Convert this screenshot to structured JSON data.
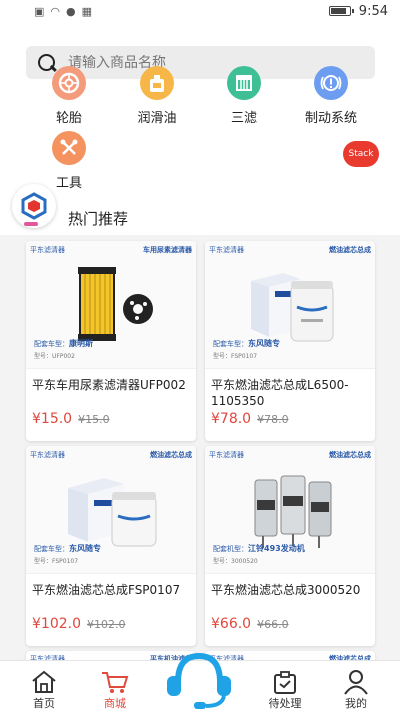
{
  "status_bar": {
    "time": "9:54"
  },
  "search": {
    "placeholder": "请输入商品名称"
  },
  "categories": [
    {
      "label": "轮胎",
      "icon": "tire-icon",
      "color": "#f39b7b"
    },
    {
      "label": "润滑油",
      "icon": "oil-bottle-icon",
      "color": "#f7b648"
    },
    {
      "label": "三滤",
      "icon": "filter-icon",
      "color": "#3fbf95"
    },
    {
      "label": "制动系统",
      "icon": "brake-warning-icon",
      "color": "#6d9df0"
    },
    {
      "label": "工具",
      "icon": "tools-icon",
      "color": "#f4935f"
    }
  ],
  "stack_button": {
    "label": "Stack"
  },
  "hot_section": {
    "title": "热门推荐"
  },
  "products": [
    {
      "name": "平东车用尿素滤清器UFP002",
      "price": "¥15.0",
      "old_price": "¥15.0",
      "brand": "平东滤清器",
      "image_type": "车用尿素滤清器",
      "fit_label": "配套车型：",
      "fit_value": "康明斯",
      "model": "型号：UFP002"
    },
    {
      "name": "平东燃油滤芯总成L6500-1105350",
      "price": "¥78.0",
      "old_price": "¥78.0",
      "brand": "平东滤清器",
      "image_type": "燃油滤芯总成",
      "fit_label": "配套车型：",
      "fit_value": "东风随专",
      "model": "型号：FSP0107"
    },
    {
      "name": "平东燃油滤芯总成FSP0107",
      "price": "¥102.0",
      "old_price": "¥102.0",
      "brand": "平东滤清器",
      "image_type": "燃油滤芯总成",
      "fit_label": "配套车型：",
      "fit_value": "东风随专",
      "model": "型号：FSP0107"
    },
    {
      "name": "平东燃油滤芯总成3000520",
      "price": "¥66.0",
      "old_price": "¥66.0",
      "brand": "平东滤清器",
      "image_type": "燃油滤芯总成",
      "fit_label": "配套机型：",
      "fit_value": "江铃493发动机",
      "model": "型号：3000520"
    }
  ],
  "partial_cards": [
    {
      "brand": "平东滤清器",
      "image_type": "平东机油滤芯"
    },
    {
      "brand": "平东滤清器",
      "image_type": "燃油滤芯总成"
    }
  ],
  "bottom_nav": [
    {
      "label": "首页",
      "icon": "home-icon"
    },
    {
      "label": "商城",
      "icon": "cart-icon",
      "active": true
    },
    {
      "label": "待处理",
      "icon": "pending-task-icon"
    },
    {
      "label": "我的",
      "icon": "profile-icon"
    }
  ],
  "colors": {
    "accent": "#e04a3c",
    "price": "#e0473d",
    "brand_blue": "#2a5aa8",
    "headset": "#1fa2e6"
  }
}
